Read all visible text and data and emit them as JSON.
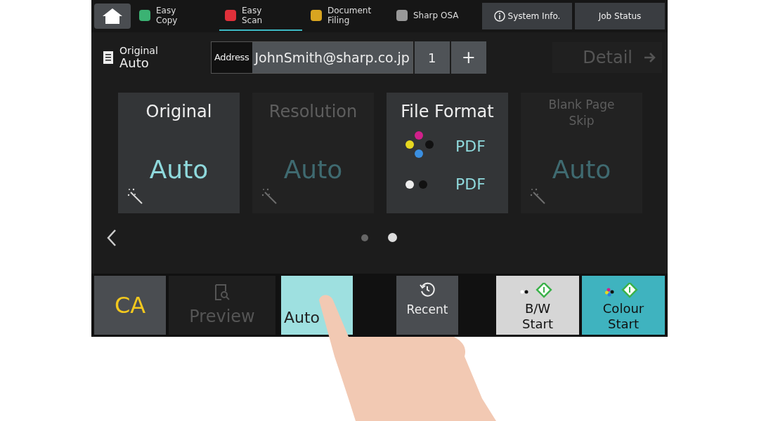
{
  "top_bar": {
    "tabs": [
      {
        "label": "Easy Copy",
        "kind": "copy",
        "selected": false
      },
      {
        "label": "Easy Scan",
        "kind": "scan",
        "selected": true
      },
      {
        "label": "Document Filing",
        "kind": "filing",
        "selected": false
      },
      {
        "label": "Sharp OSA",
        "kind": "osa",
        "selected": false
      }
    ],
    "buttons": [
      "System Info.",
      "Job Status"
    ]
  },
  "mode": {
    "label": "Original",
    "value": "Auto"
  },
  "address": {
    "label": "Address",
    "value": "JohnSmith@sharp.co.jp",
    "count": "1",
    "add": "+"
  },
  "detail": {
    "label": "Detail",
    "disabled": true
  },
  "cards": [
    {
      "kind": "value",
      "title": "Original",
      "value": "Auto",
      "disabled": false
    },
    {
      "kind": "value",
      "title": "Resolution",
      "value": "Auto",
      "disabled": true
    },
    {
      "kind": "format",
      "title": "File Format",
      "colour": "PDF",
      "mono": "PDF",
      "disabled": false
    },
    {
      "kind": "value",
      "title": "Blank Page Skip",
      "value": "Auto",
      "disabled": true
    }
  ],
  "pager": [
    {
      "selected": false
    },
    {
      "selected": true
    }
  ],
  "bottom_bar": [
    {
      "kind": "ca",
      "label": "CA"
    },
    {
      "kind": "preview",
      "label": "Preview"
    },
    {
      "kind": "autoset",
      "label": "Auto"
    },
    {
      "kind": "recent",
      "label": "Recent"
    },
    {
      "kind": "bw",
      "label": "B/W Start"
    },
    {
      "kind": "colour",
      "label": "Colour Start"
    }
  ]
}
